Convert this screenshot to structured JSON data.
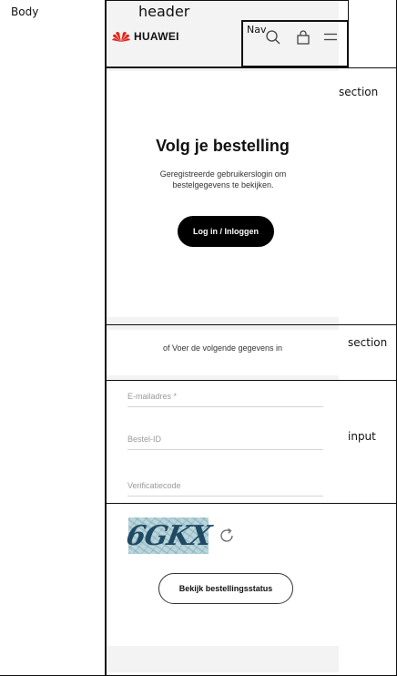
{
  "annotations": {
    "body": "Body",
    "header": "header",
    "nav": "Nav",
    "section_1": "section",
    "section_2": "section",
    "input": "input"
  },
  "header": {
    "brand_name": "HUAWEI",
    "brand_color": "#e1251b",
    "icons": [
      "search-icon",
      "bag-icon",
      "menu-icon"
    ]
  },
  "track_order": {
    "title": "Volg je bestelling",
    "subtitle": "Geregistreerde gebruikerslogin om bestelgegevens te bekijken.",
    "login_button": "Log in / Inloggen"
  },
  "alternative": {
    "text": "of Voer de volgende gegevens in"
  },
  "form": {
    "email_placeholder": "E-mailadres *",
    "order_id_placeholder": "Bestel-ID",
    "verification_placeholder": "Verificatiecode",
    "captcha_text": "6GKX",
    "submit_button": "Bekijk bestellingsstatus"
  }
}
